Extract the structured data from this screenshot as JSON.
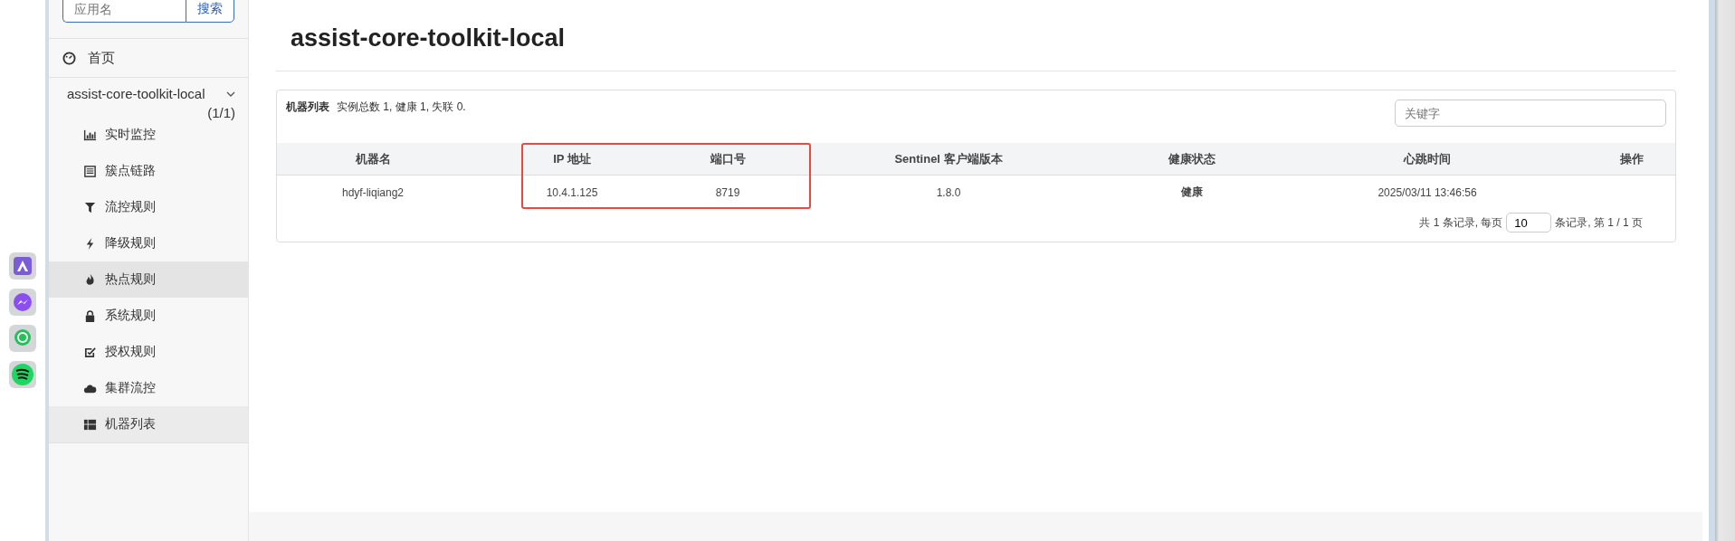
{
  "sidebar": {
    "search": {
      "placeholder": "应用名",
      "button": "搜索"
    },
    "home": {
      "label": "首页"
    },
    "app": {
      "name": "assist-core-toolkit-local",
      "count": "(1/1)",
      "expanded": true,
      "items": [
        {
          "label": "实时监控",
          "selected": false,
          "hovered": false
        },
        {
          "label": "簇点链路",
          "selected": false,
          "hovered": false
        },
        {
          "label": "流控规则",
          "selected": false,
          "hovered": false
        },
        {
          "label": "降级规则",
          "selected": false,
          "hovered": false
        },
        {
          "label": "热点规则",
          "selected": false,
          "hovered": true
        },
        {
          "label": "系统规则",
          "selected": false,
          "hovered": false
        },
        {
          "label": "授权规则",
          "selected": false,
          "hovered": false
        },
        {
          "label": "集群流控",
          "selected": false,
          "hovered": false
        },
        {
          "label": "机器列表",
          "selected": true,
          "hovered": false
        }
      ]
    }
  },
  "page": {
    "title": "assist-core-toolkit-local"
  },
  "panel": {
    "title": "机器列表",
    "summary": "实例总数 1, 健康 1, 失联 0.",
    "search": {
      "placeholder": "关键字"
    },
    "table": {
      "columns": [
        {
          "label": "机器名",
          "highlighted": false
        },
        {
          "label": "IP 地址",
          "highlighted": true
        },
        {
          "label": "端口号",
          "highlighted": true
        },
        {
          "label": "Sentinel 客户端版本",
          "highlighted": false
        },
        {
          "label": "健康状态",
          "highlighted": false
        },
        {
          "label": "心跳时间",
          "highlighted": false
        },
        {
          "label": "操作",
          "highlighted": false
        }
      ],
      "rows": [
        {
          "cells": [
            "hdyf-liqiang2",
            "10.4.1.125",
            "8719",
            "1.8.0",
            "健康",
            "2025/03/11 13:46:56",
            ""
          ]
        }
      ]
    },
    "pagination": {
      "before": "共 1 条记录, 每页",
      "page_size": "10",
      "after": "条记录, 第 1 / 1 页"
    }
  }
}
